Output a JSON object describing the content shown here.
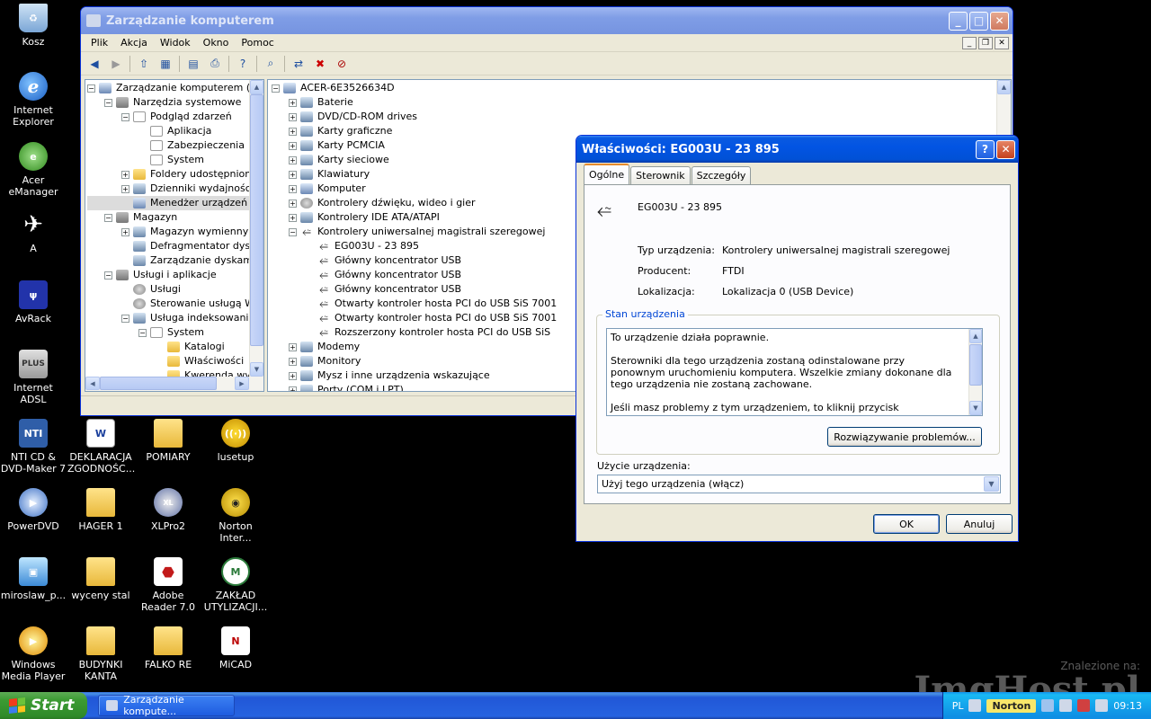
{
  "desktop": {
    "icons": [
      {
        "label": "Kosz"
      },
      {
        "label": "Internet Explorer"
      },
      {
        "label": "Acer eManager"
      },
      {
        "label": "A"
      },
      {
        "label": "AvRack"
      },
      {
        "label": "Internet ADSL"
      },
      {
        "label": "NTI CD & DVD-Maker 7"
      },
      {
        "label": "DEKLARACJA ZGODNOŚC..."
      },
      {
        "label": "POMIARY"
      },
      {
        "label": "lusetup"
      },
      {
        "label": "PowerDVD"
      },
      {
        "label": "HAGER 1"
      },
      {
        "label": "XLPro2"
      },
      {
        "label": "Norton Inter..."
      },
      {
        "label": "miroslaw_p..."
      },
      {
        "label": "wyceny stal"
      },
      {
        "label": "Adobe Reader 7.0"
      },
      {
        "label": "ZAKŁAD UTYLIZACJI..."
      },
      {
        "label": "Windows Media Player"
      },
      {
        "label": "BUDYNKI KANTA"
      },
      {
        "label": "FALKO RE"
      },
      {
        "label": "MiCAD"
      }
    ]
  },
  "main_window": {
    "title": "Zarządzanie komputerem",
    "menu": [
      "Plik",
      "Akcja",
      "Widok",
      "Okno",
      "Pomoc"
    ],
    "left_tree": [
      {
        "label": "Zarządzanie komputerem (lokalne",
        "level": 0,
        "exp": "-",
        "icon": "comp"
      },
      {
        "label": "Narzędzia systemowe",
        "level": 1,
        "exp": "-",
        "icon": "tool"
      },
      {
        "label": "Podgląd zdarzeń",
        "level": 2,
        "exp": "-",
        "icon": "ev"
      },
      {
        "label": "Aplikacja",
        "level": 3,
        "exp": "",
        "icon": "ev"
      },
      {
        "label": "Zabezpieczenia",
        "level": 3,
        "exp": "",
        "icon": "ev"
      },
      {
        "label": "System",
        "level": 3,
        "exp": "",
        "icon": "ev"
      },
      {
        "label": "Foldery udostępnione",
        "level": 2,
        "exp": "+",
        "icon": "folder"
      },
      {
        "label": "Dzienniki wydajności i aler",
        "level": 2,
        "exp": "+",
        "icon": "dev"
      },
      {
        "label": "Menedżer urządzeń",
        "level": 2,
        "exp": "",
        "icon": "comp",
        "selected": true
      },
      {
        "label": "Magazyn",
        "level": 1,
        "exp": "-",
        "icon": "tool"
      },
      {
        "label": "Magazyn wymienny",
        "level": 2,
        "exp": "+",
        "icon": "dev"
      },
      {
        "label": "Defragmentator dysków",
        "level": 2,
        "exp": "",
        "icon": "dev"
      },
      {
        "label": "Zarządzanie dyskami",
        "level": 2,
        "exp": "",
        "icon": "dev"
      },
      {
        "label": "Usługi i aplikacje",
        "level": 1,
        "exp": "-",
        "icon": "tool"
      },
      {
        "label": "Usługi",
        "level": 2,
        "exp": "",
        "icon": "gear"
      },
      {
        "label": "Sterowanie usługą WMI",
        "level": 2,
        "exp": "",
        "icon": "gear"
      },
      {
        "label": "Usługa indeksowania",
        "level": 2,
        "exp": "-",
        "icon": "dev"
      },
      {
        "label": "System",
        "level": 3,
        "exp": "-",
        "icon": "ev"
      },
      {
        "label": "Katalogi",
        "level": 4,
        "exp": "",
        "icon": "folder"
      },
      {
        "label": "Właściwości",
        "level": 4,
        "exp": "",
        "icon": "folder"
      },
      {
        "label": "Kwerenda wykaz",
        "level": 4,
        "exp": "",
        "icon": "folder"
      }
    ],
    "right_tree": [
      {
        "label": "ACER-6E3526634D",
        "level": 0,
        "exp": "-",
        "icon": "comp"
      },
      {
        "label": "Baterie",
        "level": 1,
        "exp": "+",
        "icon": "dev"
      },
      {
        "label": "DVD/CD-ROM drives",
        "level": 1,
        "exp": "+",
        "icon": "dev"
      },
      {
        "label": "Karty graficzne",
        "level": 1,
        "exp": "+",
        "icon": "dev"
      },
      {
        "label": "Karty PCMCIA",
        "level": 1,
        "exp": "+",
        "icon": "dev"
      },
      {
        "label": "Karty sieciowe",
        "level": 1,
        "exp": "+",
        "icon": "dev"
      },
      {
        "label": "Klawiatury",
        "level": 1,
        "exp": "+",
        "icon": "dev"
      },
      {
        "label": "Komputer",
        "level": 1,
        "exp": "+",
        "icon": "comp"
      },
      {
        "label": "Kontrolery dźwięku, wideo i gier",
        "level": 1,
        "exp": "+",
        "icon": "gear"
      },
      {
        "label": "Kontrolery IDE ATA/ATAPI",
        "level": 1,
        "exp": "+",
        "icon": "dev"
      },
      {
        "label": "Kontrolery uniwersalnej magistrali szeregowej",
        "level": 1,
        "exp": "-",
        "icon": "usb"
      },
      {
        "label": "EG003U - 23 895",
        "level": 2,
        "exp": "",
        "icon": "usb"
      },
      {
        "label": "Główny koncentrator USB",
        "level": 2,
        "exp": "",
        "icon": "usb"
      },
      {
        "label": "Główny koncentrator USB",
        "level": 2,
        "exp": "",
        "icon": "usb"
      },
      {
        "label": "Główny koncentrator USB",
        "level": 2,
        "exp": "",
        "icon": "usb"
      },
      {
        "label": "Otwarty kontroler hosta PCI do USB SiS 7001",
        "level": 2,
        "exp": "",
        "icon": "usb"
      },
      {
        "label": "Otwarty kontroler hosta PCI do USB SiS 7001",
        "level": 2,
        "exp": "",
        "icon": "usb"
      },
      {
        "label": "Rozszerzony kontroler hosta PCI do USB SiS",
        "level": 2,
        "exp": "",
        "icon": "usb"
      },
      {
        "label": "Modemy",
        "level": 1,
        "exp": "+",
        "icon": "dev"
      },
      {
        "label": "Monitory",
        "level": 1,
        "exp": "+",
        "icon": "dev"
      },
      {
        "label": "Mysz i inne urządzenia wskazujące",
        "level": 1,
        "exp": "+",
        "icon": "dev"
      },
      {
        "label": "Porty (COM i LPT)",
        "level": 1,
        "exp": "+",
        "icon": "dev"
      }
    ]
  },
  "dialog": {
    "title": "Właściwości: EG003U - 23 895",
    "tabs": [
      "Ogólne",
      "Sterownik",
      "Szczegóły"
    ],
    "device_name": "EG003U - 23 895",
    "type_label": "Typ urządzenia:",
    "type_value": "Kontrolery uniwersalnej magistrali szeregowej",
    "manufacturer_label": "Producent:",
    "manufacturer_value": "FTDI",
    "location_label": "Lokalizacja:",
    "location_value": "Lokalizacja 0 (USB Device)",
    "status_group": "Stan urządzenia",
    "status_line1": "To urządzenie działa poprawnie.",
    "status_line2": "Sterowniki dla tego urządzenia zostaną odinstalowane przy ponownym uruchomieniu komputera. Wszelkie zmiany dokonane dla tego urządzenia nie zostaną zachowane.",
    "status_line3": "Jeśli masz problemy z tym urządzeniem, to kliknij przycisk Rozwiązywanie",
    "troubleshoot_button": "Rozwiązywanie problemów...",
    "usage_label": "Użycie urządzenia:",
    "usage_value": "Użyj tego urządzenia (włącz)",
    "ok_button": "OK",
    "cancel_button": "Anuluj"
  },
  "taskbar": {
    "start_label": "Start",
    "task_label": "Zarządzanie kompute...",
    "lang": "PL",
    "norton": "Norton",
    "clock": "09:13"
  },
  "watermark": {
    "line1": "Znalezione na:",
    "line2": "ImgHost.pl"
  }
}
